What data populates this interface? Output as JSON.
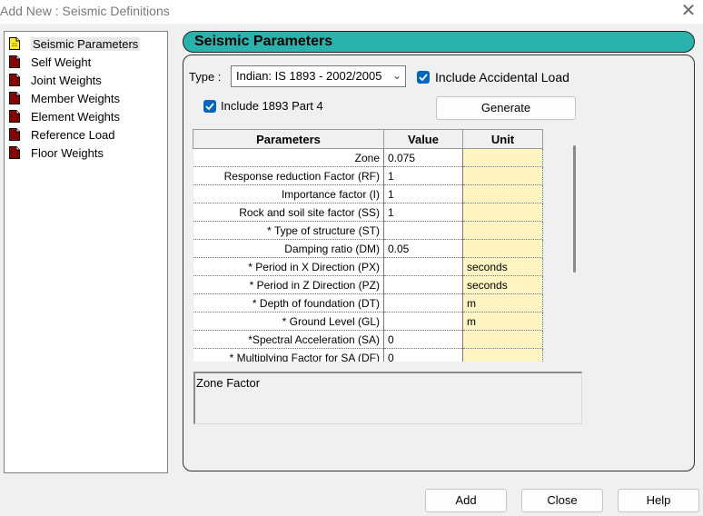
{
  "window": {
    "title": "Add New : Seismic Definitions",
    "close_icon": "✕"
  },
  "tree": {
    "items": [
      {
        "label": "Seismic Parameters",
        "icon": "yellow-page-icon",
        "selected": true
      },
      {
        "label": "Self Weight",
        "icon": "red-page-icon"
      },
      {
        "label": "Joint Weights",
        "icon": "red-page-icon"
      },
      {
        "label": "Member Weights",
        "icon": "red-page-icon"
      },
      {
        "label": "Element Weights",
        "icon": "red-page-icon"
      },
      {
        "label": "Reference Load",
        "icon": "red-page-icon"
      },
      {
        "label": "Floor Weights",
        "icon": "red-page-icon"
      }
    ]
  },
  "panel": {
    "title": "Seismic Parameters",
    "type_label": "Type :",
    "type_value": "Indian: IS 1893 - 2002/2005",
    "include_accidental": {
      "label": "Include Accidental Load",
      "checked": true
    },
    "include_1893": {
      "label": "Include 1893 Part 4",
      "checked": true
    },
    "generate_label": "Generate",
    "table": {
      "headers": [
        "Parameters",
        "Value",
        "Unit"
      ],
      "rows": [
        {
          "param": "Zone",
          "value": "0.075",
          "unit": ""
        },
        {
          "param": "Response reduction Factor (RF)",
          "value": "1",
          "unit": ""
        },
        {
          "param": "Importance factor (I)",
          "value": "1",
          "unit": ""
        },
        {
          "param": "Rock and soil site factor (SS)",
          "value": "1",
          "unit": ""
        },
        {
          "param": "* Type of structure (ST)",
          "value": "",
          "unit": ""
        },
        {
          "param": "Damping ratio (DM)",
          "value": "0.05",
          "unit": ""
        },
        {
          "param": "* Period in X Direction (PX)",
          "value": "",
          "unit": "seconds"
        },
        {
          "param": "* Period in Z Direction (PZ)",
          "value": "",
          "unit": "seconds"
        },
        {
          "param": "* Depth of foundation (DT)",
          "value": "",
          "unit": "m"
        },
        {
          "param": "* Ground Level (GL)",
          "value": "",
          "unit": "m"
        },
        {
          "param": "*Spectral Acceleration (SA)",
          "value": "0",
          "unit": ""
        },
        {
          "param": "* Multiplying Factor for SA (DF)",
          "value": "0",
          "unit": ""
        }
      ]
    },
    "description": "Zone Factor"
  },
  "buttons": {
    "add": "Add",
    "close": "Close",
    "help": "Help"
  },
  "colors": {
    "header_teal": "#2ab3ad",
    "unit_cell": "#fff5c2",
    "checkbox": "#0067c0"
  }
}
